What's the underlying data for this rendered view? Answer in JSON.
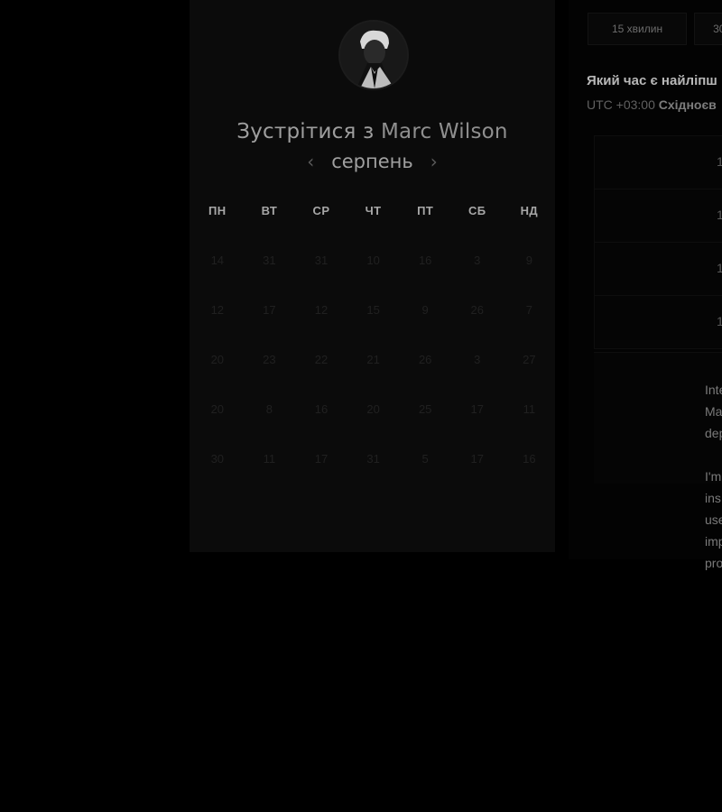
{
  "calendar": {
    "title_prefix": "Зустрітися з",
    "host_name": "Marc Wilson",
    "month": "серпень",
    "weekdays": [
      "ПН",
      "ВТ",
      "СР",
      "ЧТ",
      "ПТ",
      "СБ",
      "НД"
    ],
    "days": [
      [
        "14",
        "31",
        "31",
        "10",
        "16",
        "3",
        "9"
      ],
      [
        "12",
        "17",
        "12",
        "15",
        "9",
        "26",
        "7"
      ],
      [
        "20",
        "23",
        "22",
        "21",
        "26",
        "3",
        "27"
      ],
      [
        "20",
        "8",
        "16",
        "20",
        "25",
        "17",
        "11"
      ],
      [
        "30",
        "11",
        "17",
        "31",
        "5",
        "17",
        "16"
      ]
    ]
  },
  "durations": [
    "15 хвилин",
    "30"
  ],
  "question": "Який час є найліпш",
  "timezone": {
    "offset": "UTC +03:00",
    "name": "Східноєв"
  },
  "time_slots": [
    "1",
    "1",
    "1",
    "1"
  ],
  "description": {
    "paragraph1": [
      "Inte",
      "Ma",
      "dep"
    ],
    "paragraph2": [
      "I'm",
      "ins",
      "use",
      "imp",
      "pro"
    ]
  }
}
